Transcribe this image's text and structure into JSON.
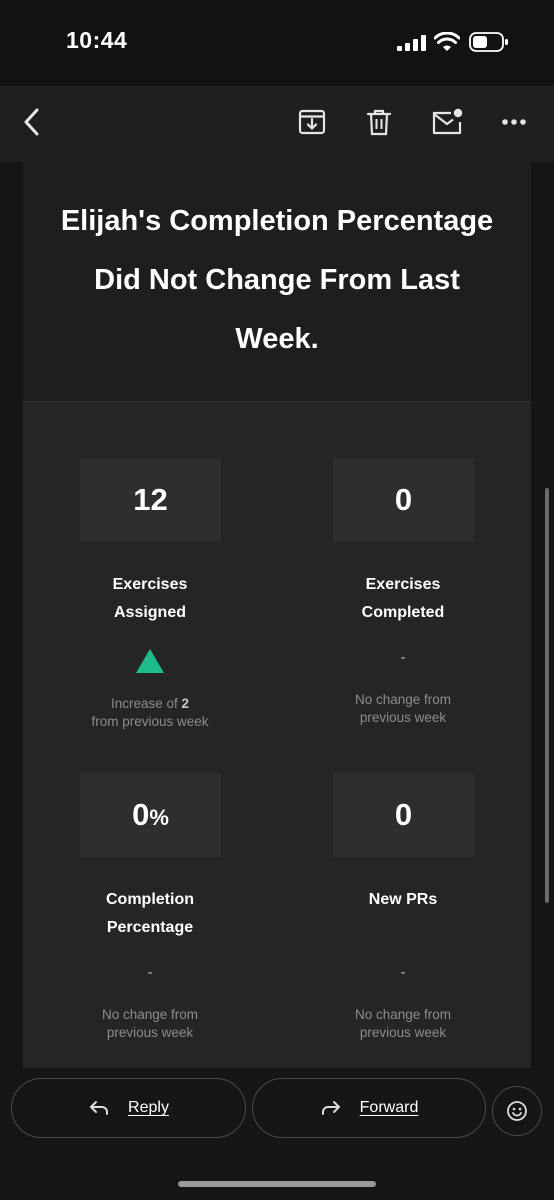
{
  "status_bar": {
    "time": "10:44",
    "ghost_top": "...",
    "signal_icon": "cellular-signal",
    "wifi_icon": "wifi",
    "battery_icon": "battery"
  },
  "toolbar": {
    "back_icon": "chevron-left",
    "archive_icon": "archive-download",
    "delete_icon": "trash",
    "mark_unread_icon": "mail-unread",
    "more_icon": "ellipsis"
  },
  "email": {
    "headline": "Elijah's Completion Percentage Did Not Change From Last Week.",
    "stats": [
      {
        "value": "12",
        "unit": "",
        "label_line1": "Exercises",
        "label_line2": "Assigned",
        "trend": "up",
        "note_prefix": "Increase of ",
        "note_bold": "2",
        "note_line2": "from previous week",
        "dash": ""
      },
      {
        "value": "0",
        "unit": "",
        "label_line1": "Exercises",
        "label_line2": "Completed",
        "trend": "none",
        "dash": "-",
        "note_line1": "No change from",
        "note_line2": "previous week"
      },
      {
        "value": "0",
        "unit": "%",
        "label_line1": "Completion",
        "label_line2": "Percentage",
        "trend": "none",
        "dash": "-",
        "note_line1": "No change from",
        "note_line2": "previous week"
      },
      {
        "value": "0",
        "unit": "",
        "label_line1": "New PRs",
        "label_line2": "",
        "trend": "none",
        "dash": "-",
        "note_line1": "No change from",
        "note_line2": "previous week"
      }
    ],
    "colors": {
      "trend_up": "#1ebc8a",
      "card_bg": "#252527",
      "stat_box_bg": "#2e2e30"
    }
  },
  "bottom_bar": {
    "reply_label": "Reply",
    "forward_label": "Forward",
    "reply_icon": "reply-arrow",
    "forward_icon": "forward-arrow",
    "emoji_icon": "smiley-face"
  }
}
